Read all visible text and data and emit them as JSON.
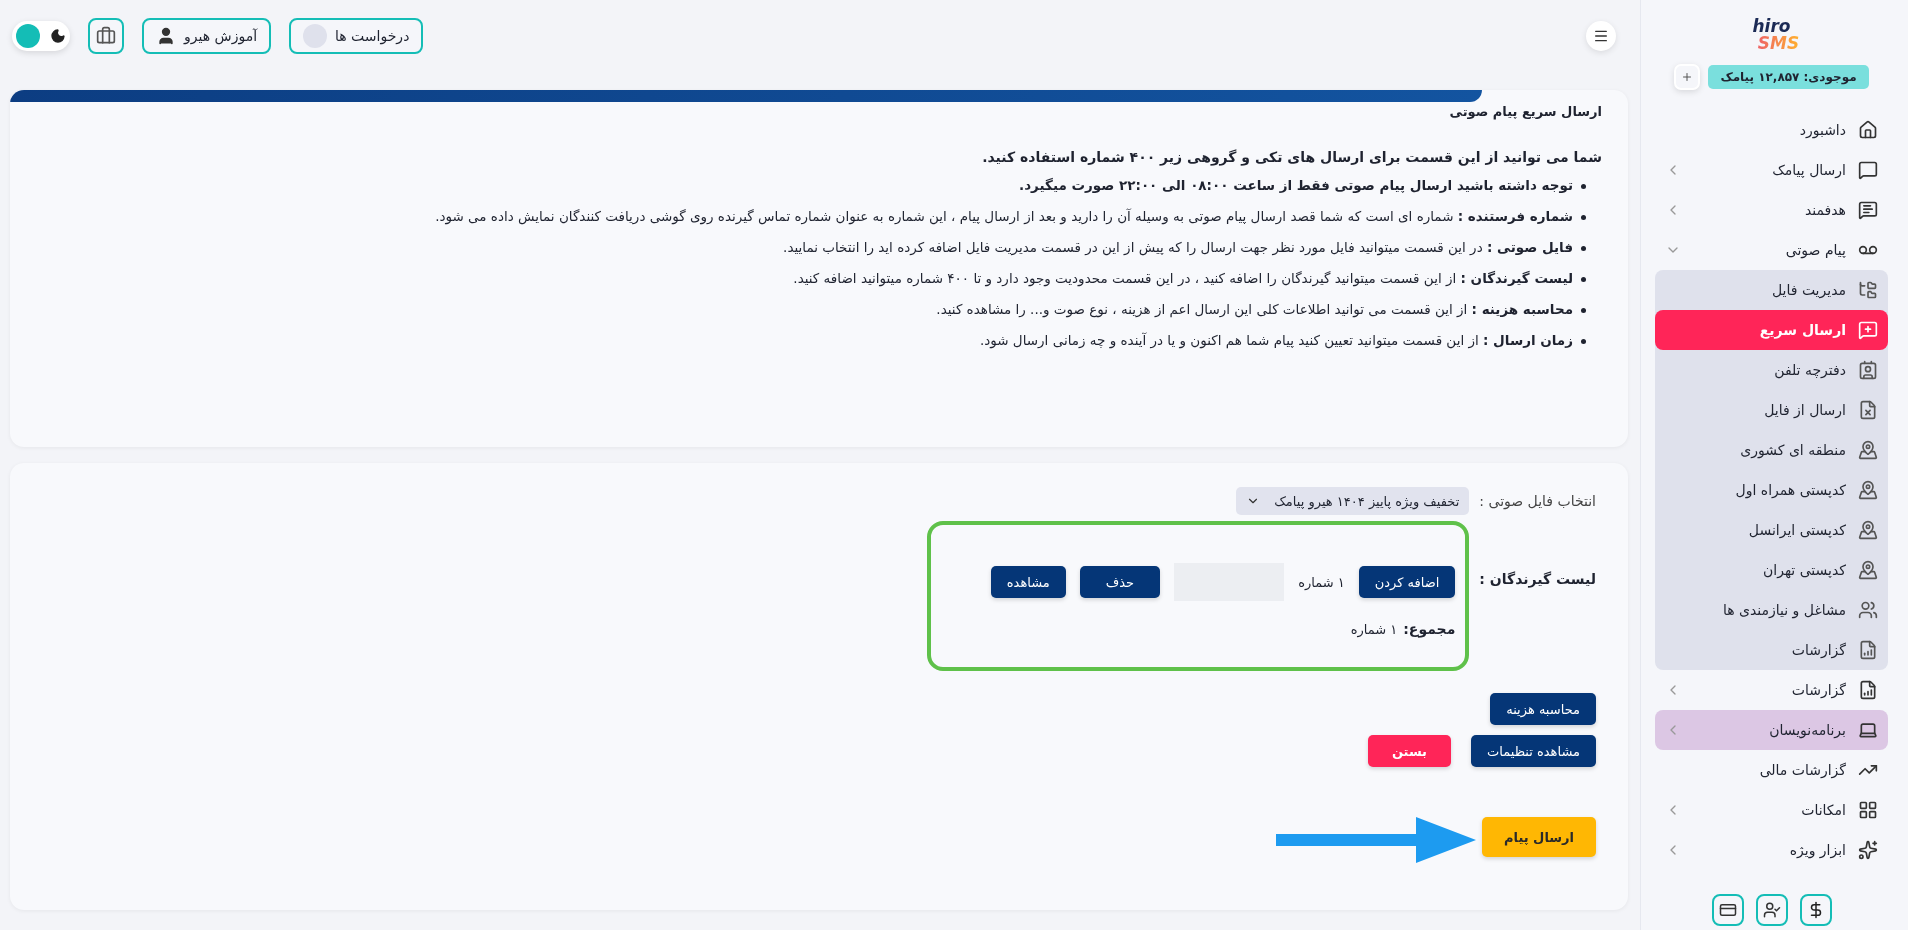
{
  "topbar": {
    "dark_mode": false,
    "buttons": [
      {
        "kind": "requests",
        "label": "درخواست ها"
      },
      {
        "kind": "tutorial",
        "label": "آموزش هیرو"
      }
    ]
  },
  "sidebar": {
    "logo": {
      "line1": "hiro",
      "line2": "SMS"
    },
    "balance": "موجودی: ۱۲,۸۵۷ پیامک",
    "items": [
      {
        "kind": "link",
        "label": "داشبورد",
        "highlighted": false
      },
      {
        "kind": "group",
        "label": "ارسال پیامک",
        "expanded": false,
        "highlighted": false
      },
      {
        "kind": "group",
        "label": "هدفمند",
        "expanded": false,
        "highlighted": false
      },
      {
        "kind": "group",
        "label": "پیام صوتی",
        "expanded": true,
        "highlighted": false,
        "children": [
          {
            "label": "مدیریت فایل",
            "selected": false
          },
          {
            "label": "ارسال سریع",
            "selected": true
          },
          {
            "label": "دفترچه تلفن",
            "selected": false
          },
          {
            "label": "ارسال از فایل",
            "selected": false
          },
          {
            "label": "منطقه ای کشوری",
            "selected": false
          },
          {
            "label": "کدپستی همراه اول",
            "selected": false
          },
          {
            "label": "کدپستی ایرانسل",
            "selected": false
          },
          {
            "label": "کدپستی تهران",
            "selected": false
          },
          {
            "label": "مشاغل و نیازمندی ها",
            "selected": false
          },
          {
            "label": "گزارشات",
            "selected": false
          }
        ]
      },
      {
        "kind": "group",
        "label": "گزارشات",
        "expanded": false,
        "highlighted": false
      },
      {
        "kind": "group",
        "label": "برنامه‌نویسان",
        "expanded": false,
        "highlighted": true
      },
      {
        "kind": "link",
        "label": "گزارشات مالی",
        "highlighted": false
      },
      {
        "kind": "group",
        "label": "امکانات",
        "expanded": false,
        "highlighted": false
      },
      {
        "kind": "group",
        "label": "ابزار ویژه",
        "expanded": false,
        "highlighted": false
      }
    ]
  },
  "info": {
    "title": "ارسال سریع پیام صوتی",
    "intro": "شما می توانید از این قسمت برای ارسال های تکی و گروهی زیر ۴۰۰ شماره استفاده کنید.",
    "notes": [
      {
        "text": "توجه داشته باشید ارسال پیام صوتی فقط از ساعت ۰۸:۰۰ الی ۲۲:۰۰ صورت میگیرد.",
        "bold": true
      },
      {
        "text": "**شماره فرستنده :** شماره ای است که شما قصد ارسال پیام صوتی به وسیله آن را دارید و بعد از ارسال پیام ، این شماره به عنوان شماره تماس گیرنده روی گوشی دریافت کنندگان نمایش داده می شود.",
        "bold": false
      },
      {
        "text": "**فایل صوتی :** در این قسمت میتوانید فایل مورد نظر جهت ارسال را که پیش از این در قسمت مدیریت فایل اضافه کرده اید را انتخاب نمایید.",
        "bold": false
      },
      {
        "text": "**لیست گیرندگان :** از این قسمت میتوانید گیرندگان را اضافه کنید ، در این قسمت محدودیت وجود دارد و تا ۴۰۰ شماره میتوانید اضافه کنید.",
        "bold": false
      },
      {
        "text": "**محاسبه هزینه :** از این قسمت می توانید اطلاعات کلی این ارسال اعم از هزینه ، نوع صوت و... را مشاهده کنید.",
        "bold": false
      },
      {
        "text": "**زمان ارسال :** از این قسمت میتوانید تعیین کنید پیام شما هم اکنون و یا در آینده و چه زمانی ارسال شود.",
        "bold": false
      }
    ]
  },
  "form": {
    "file_label": "انتخاب فایل صوتی :",
    "file_value": "تخفیف ویژه پاییز ۱۴۰۴ هیرو پیامک",
    "recipients_label": "لیست گیرندگان :",
    "add_button": "اضافه کردن",
    "count": "۱ شماره",
    "delete_button": "حذف",
    "view_button": "مشاهده",
    "total_label": "مجموع:",
    "total_value": "۱ شماره",
    "actions": [
      {
        "kind": "primary",
        "label": "محاسبه هزینه"
      },
      {
        "kind": "primary",
        "label": "مشاهده تنظیمات"
      },
      {
        "kind": "danger",
        "label": "بستن"
      }
    ],
    "send_button": "ارسال پیام"
  }
}
